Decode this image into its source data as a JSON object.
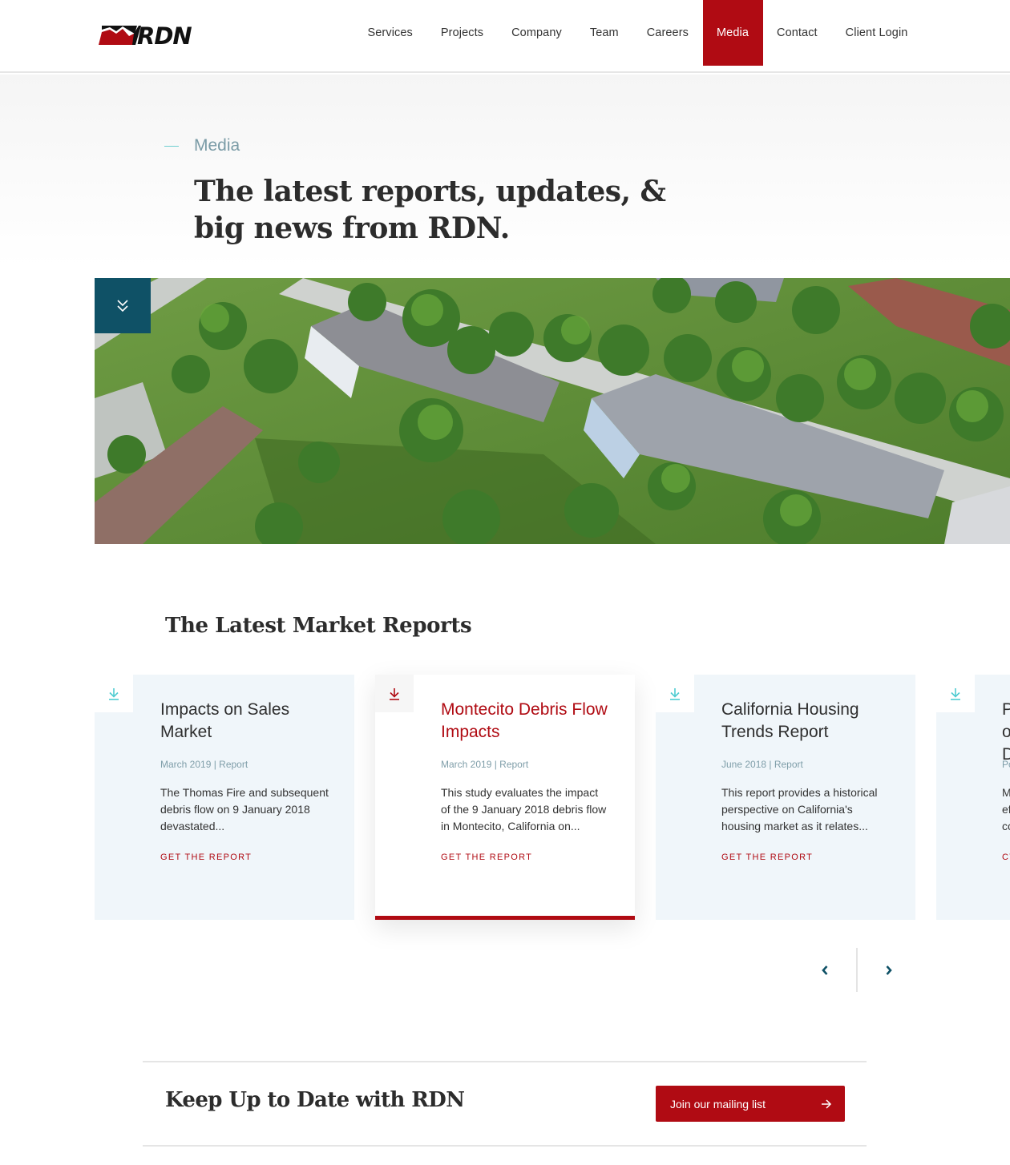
{
  "brand": {
    "name": "RDN",
    "colors": {
      "primary_red": "#b00b13",
      "teal_dark": "#0f5166",
      "teal_light": "#6fcfd0",
      "meta_gray_blue": "#7f9ea9",
      "card_bg": "#f0f6fa"
    }
  },
  "nav": {
    "items": [
      {
        "label": "Services",
        "active": false
      },
      {
        "label": "Projects",
        "active": false
      },
      {
        "label": "Company",
        "active": false
      },
      {
        "label": "Team",
        "active": false
      },
      {
        "label": "Careers",
        "active": false
      },
      {
        "label": "Media",
        "active": true
      },
      {
        "label": "Contact",
        "active": false
      },
      {
        "label": "Client Login",
        "active": false
      }
    ]
  },
  "hero": {
    "eyebrow": "Media",
    "title": "The latest reports, updates, & big news from RDN.",
    "image_alt": "Aerial view of suburban townhouses and trees",
    "scroll_icon": "double-chevron-down-icon"
  },
  "reports": {
    "section_title": "The Latest Market Reports",
    "cards": [
      {
        "title": "Impacts on Sales Market",
        "meta": "March 2019 | Report",
        "description": "The Thomas Fire and subsequent debris flow on 9 January 2018 devastated...",
        "cta": "GET THE REPORT",
        "icon": "download-icon",
        "featured": false
      },
      {
        "title": "Montecito Debris Flow Impacts",
        "meta": "March 2019 | Report",
        "description": "This study evaluates the impact of the 9 January 2018 debris flow in Montecito, California on...",
        "cta": "GET THE REPORT",
        "icon": "download-icon",
        "featured": true
      },
      {
        "title": "California Housing Trends Report",
        "meta": "June 2018 | Report",
        "description": "This report provides a historical perspective on California's housing market as it relates...",
        "cta": "GET THE REPORT",
        "icon": "download-icon",
        "featured": false
      },
      {
        "title": "P o D",
        "meta": "Po",
        "description": "M ef co",
        "cta": "CT",
        "icon": "download-icon",
        "featured": false
      }
    ],
    "pager": {
      "prev_icon": "chevron-left-icon",
      "next_icon": "chevron-right-icon"
    }
  },
  "newsletter": {
    "title": "Keep Up to Date with RDN",
    "button_label": "Join our mailing list",
    "button_icon": "arrow-right-icon"
  }
}
